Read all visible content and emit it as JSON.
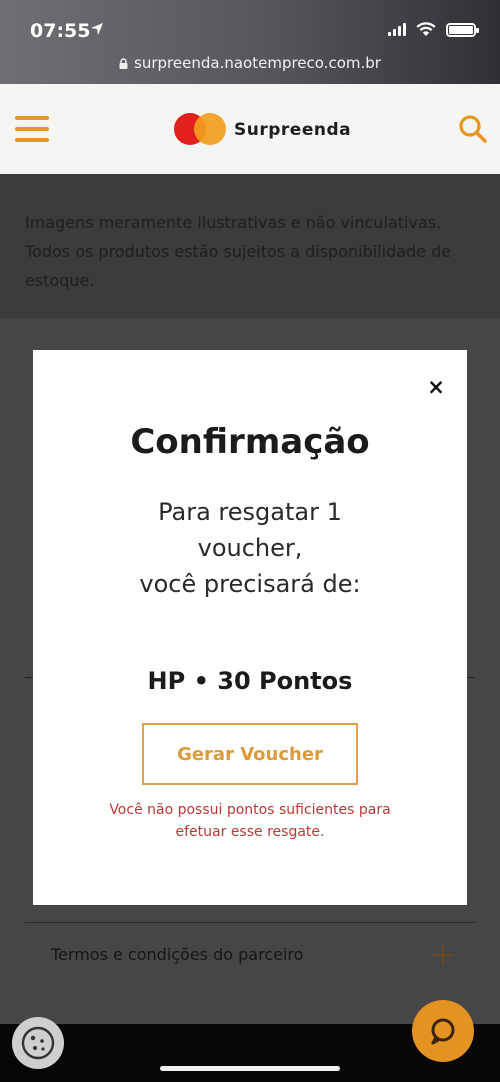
{
  "status_bar": {
    "time": "07:55"
  },
  "browser": {
    "url": "surpreenda.naotempreco.com.br"
  },
  "header": {
    "brand": "Surpreenda"
  },
  "page": {
    "disclaimer": "Imagens meramente ilustrativas e não vinculativas. Todos os produtos estão sujeitos a disponibilidade de estoque.",
    "terms_label": "Termos e condições do parceiro"
  },
  "modal": {
    "title": "Confirmação",
    "line1": "Para resgatar 1",
    "line2": "voucher,",
    "line3": "você precisará de:",
    "points": "HP • 30 Pontos",
    "button_label": "Gerar Voucher",
    "error_line1": "Você não possui pontos suficientes para",
    "error_line2": "efetuar esse resgate.",
    "close_label": "×"
  },
  "colors": {
    "accent": "#e7961f",
    "error": "#b73a36",
    "logo_red": "#e0211d",
    "logo_orange": "#f19e1f"
  }
}
